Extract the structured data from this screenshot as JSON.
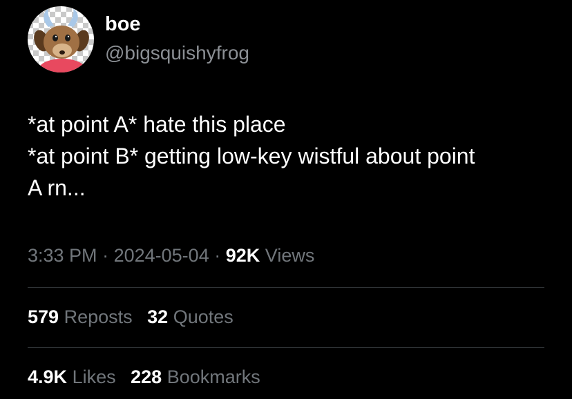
{
  "author": {
    "display_name": "boe",
    "handle": "@bigsquishyfrog"
  },
  "tweet": {
    "lines": [
      "*at point A* hate this place",
      "*at point B* getting low-key wistful about point",
      "A rn..."
    ]
  },
  "meta": {
    "time": "3:33 PM",
    "separator": "·",
    "date": "2024-05-04",
    "views_count": "92K",
    "views_label": "Views"
  },
  "stats": {
    "reposts": {
      "count": "579",
      "label": "Reposts"
    },
    "quotes": {
      "count": "32",
      "label": "Quotes"
    },
    "likes": {
      "count": "4.9K",
      "label": "Likes"
    },
    "bookmarks": {
      "count": "228",
      "label": "Bookmarks"
    }
  },
  "colors": {
    "background": "#000000",
    "primary_text": "#ffffff",
    "secondary_text": "#71767b",
    "divider": "#2f3336"
  },
  "icons": {
    "avatar": "goat-character-avatar"
  }
}
